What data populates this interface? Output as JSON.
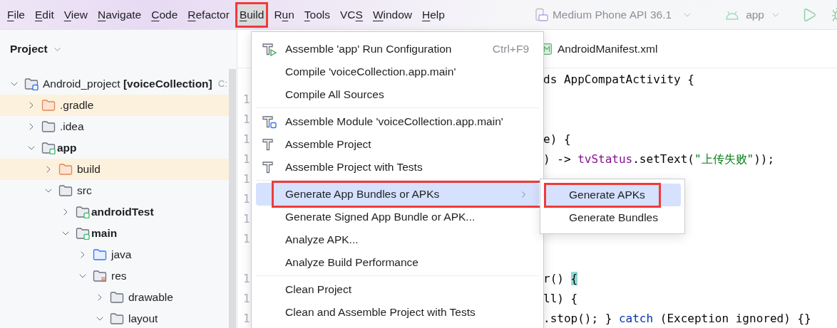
{
  "menu_bar": {
    "items": [
      {
        "key": "F",
        "after": "ile",
        "selected": false,
        "annotated": false
      },
      {
        "key": "E",
        "after": "dit",
        "selected": false,
        "annotated": false
      },
      {
        "key": "V",
        "after": "iew",
        "selected": false,
        "annotated": false
      },
      {
        "key": "N",
        "after": "avigate",
        "selected": false,
        "annotated": false
      },
      {
        "key": "C",
        "after": "ode",
        "selected": false,
        "annotated": false
      },
      {
        "key": "R",
        "after": "efactor",
        "selected": false,
        "annotated": false
      },
      {
        "key": "B",
        "after": "uild",
        "selected": true,
        "annotated": true
      },
      {
        "before": "R",
        "key": "u",
        "after": "n",
        "selected": false,
        "annotated": false
      },
      {
        "key": "T",
        "after": "ools",
        "selected": false,
        "annotated": false
      },
      {
        "before": "VC",
        "key": "S",
        "selected": false,
        "annotated": false
      },
      {
        "key": "W",
        "after": "indow",
        "selected": false,
        "annotated": false
      },
      {
        "key": "H",
        "after": "elp",
        "selected": false,
        "annotated": false
      }
    ]
  },
  "toolbar": {
    "device": "Medium Phone API 36.1",
    "run_config": "app"
  },
  "project_panel": {
    "title": "Project",
    "tree": [
      {
        "label": "Android_project **[voiceCollection]**",
        "path": "C:",
        "kind": "project",
        "expanded": true,
        "children": [
          {
            "label": ".gradle",
            "kind": "excluded",
            "expanded": false
          },
          {
            "label": ".idea",
            "kind": "folder",
            "expanded": false
          },
          {
            "label": "app",
            "kind": "module",
            "expanded": true,
            "children": [
              {
                "label": "build",
                "kind": "excluded",
                "expanded": false
              },
              {
                "label": "src",
                "kind": "folder",
                "expanded": true,
                "children": [
                  {
                    "label": "androidTest",
                    "kind": "module",
                    "expanded": false
                  },
                  {
                    "label": "main",
                    "kind": "module",
                    "expanded": true,
                    "children": [
                      {
                        "label": "java",
                        "kind": "source",
                        "expanded": false
                      },
                      {
                        "label": "res",
                        "kind": "resources",
                        "expanded": true,
                        "children": [
                          {
                            "label": "drawable",
                            "kind": "folder",
                            "expanded": false
                          },
                          {
                            "label": "layout",
                            "kind": "folder",
                            "expanded": true
                          }
                        ]
                      }
                    ]
                  }
                ]
              }
            ]
          }
        ]
      }
    ]
  },
  "editor": {
    "tabs": [
      {
        "label": "AndroidManifest.xml"
      }
    ],
    "lines": [
      {
        "kind": "unnumbered",
        "code": [
          {
            "kind": "plain",
            "text": "ds AppCompatActivity {"
          }
        ]
      },
      {
        "kind": "numbered",
        "number": "1"
      },
      {
        "kind": "numbered",
        "number": "1"
      },
      {
        "kind": "numbered",
        "number": "1",
        "code": [
          {
            "kind": "plain",
            "text": "e) {"
          }
        ]
      },
      {
        "kind": "numbered",
        "number": "1",
        "code": [
          {
            "kind": "plain",
            "text": ") -> "
          },
          {
            "kind": "field",
            "text": "tvStatus"
          },
          {
            "kind": "plain",
            "text": ".setText("
          },
          {
            "kind": "string",
            "text": "\"上传失败\""
          },
          {
            "kind": "plain",
            "text": "));"
          }
        ]
      },
      {
        "kind": "numbered",
        "number": "1"
      },
      {
        "kind": "numbered",
        "number": "1"
      },
      {
        "kind": "numbered",
        "number": "1"
      },
      {
        "kind": "numbered",
        "number": "1"
      },
      {
        "kind": "unnumbered"
      },
      {
        "kind": "numbered",
        "number": "1",
        "code": [
          {
            "kind": "plain",
            "text": "r() "
          },
          {
            "kind": "brace",
            "text": "{"
          }
        ]
      },
      {
        "kind": "numbered",
        "number": "1",
        "code": [
          {
            "kind": "plain",
            "text": "ll) {"
          }
        ]
      },
      {
        "kind": "numbered",
        "number": "1",
        "code": [
          {
            "kind": "plain",
            "text": ".stop(); } "
          },
          {
            "kind": "keyword",
            "text": "catch"
          },
          {
            "kind": "plain",
            "text": " (Exception ignored) {}"
          }
        ]
      }
    ]
  },
  "build_menu": {
    "sections": [
      [
        {
          "kind": "run-config",
          "label": "Assemble 'app' Run Configuration",
          "shortcut": "Ctrl+F9",
          "submenu": false,
          "selected": false,
          "annotated": false
        },
        {
          "kind": "text",
          "label": "Compile 'voiceCollection.app.main'",
          "submenu": false,
          "selected": false,
          "annotated": false
        },
        {
          "kind": "text",
          "label": "Compile All Sources",
          "submenu": false,
          "selected": false,
          "annotated": false
        }
      ],
      [
        {
          "kind": "module",
          "label": "Assemble Module 'voiceCollection.app.main'",
          "submenu": false,
          "selected": false,
          "annotated": false
        },
        {
          "kind": "hammer",
          "label": "Assemble Project",
          "submenu": false,
          "selected": false,
          "annotated": false
        },
        {
          "kind": "hammer",
          "label": "Assemble Project with Tests",
          "submenu": false,
          "selected": false,
          "annotated": false
        }
      ],
      [
        {
          "kind": "text",
          "label": "Generate App Bundles or APKs",
          "submenu": true,
          "selected": true,
          "annotated": true
        },
        {
          "kind": "text",
          "label": "Generate Signed App Bundle or APK...",
          "submenu": false,
          "selected": false,
          "annotated": false
        },
        {
          "kind": "text",
          "label": "Analyze APK...",
          "submenu": false,
          "selected": false,
          "annotated": false
        },
        {
          "kind": "text",
          "label": "Analyze Build Performance",
          "submenu": false,
          "selected": false,
          "annotated": false
        }
      ],
      [
        {
          "kind": "text",
          "label": "Clean Project",
          "submenu": false,
          "selected": false,
          "annotated": false
        },
        {
          "kind": "text",
          "label": "Clean and Assemble Project with Tests",
          "submenu": false,
          "selected": false,
          "annotated": false
        }
      ]
    ]
  },
  "submenu": {
    "items": [
      {
        "label": "Generate APKs",
        "selected": true,
        "annotated": true
      },
      {
        "label": "Generate Bundles",
        "selected": false,
        "annotated": false
      }
    ]
  }
}
